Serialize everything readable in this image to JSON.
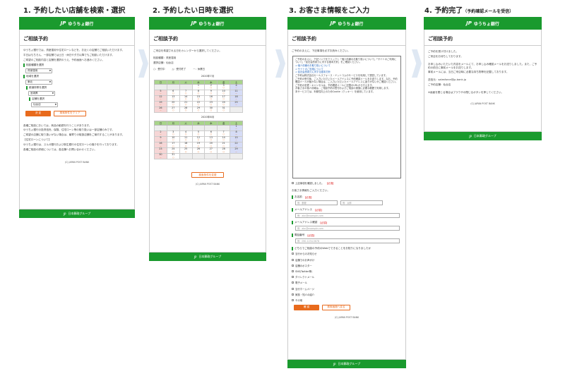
{
  "steps": [
    {
      "title": "1. 予約したい店舗を検索・選択"
    },
    {
      "title": "2. 予約したい日時を選択"
    },
    {
      "title": "3. お客さま情報をご入力"
    },
    {
      "title": "4. 予約完了",
      "note": "（予約確認メールを受信）"
    }
  ],
  "header": {
    "logo": "JP",
    "bank": "ゆうちょ銀行"
  },
  "footer": {
    "copyright": "(C) JAPAN POST BANK",
    "group": "日本郵政グループ"
  },
  "page_title": "ご相談予約",
  "p1": {
    "intro": [
      "ゆうちょ銀行では、資産運用や住宅ローンなどを、お近くの店舗でご相談いただけます。",
      "平日はもちろん、一部店舗では土日・休日や夕方以降でもご相談いただけます。",
      "ご希望のご相談内容と店舗を選択のうえ、予約画面へお進みください。"
    ],
    "f1": "相談種類を選択",
    "v1": "資産運用",
    "f2": "地域を選択",
    "v2": "東北",
    "f3": "都道府県を選択",
    "v3": "宮城県",
    "f4": "店舗を選択",
    "v4": "仙台店",
    "btn_ok": "決 定",
    "btn_clear": "検索条件をクリア",
    "notes": [
      "各種ご相談においては、商品の勧誘を行うことがあります。",
      "ゆうちょ銀行の投資信託、保険、住宅ローン等の取り扱いは一部店舗のみです。",
      "ご希望の店舗に取り扱いがない場合は、最寄りの取扱店舗をご案内することがあります。",
      "【住宅ローンについて】",
      "ゆうちょ銀行は、スルガ銀行および新生銀行の住宅ローンの媒介を行っております。",
      "各種ご相談の詳細については、各店舗へお問い合わせください。"
    ]
  },
  "p2": {
    "intro": "ご来店を希望される日をカレンダーから選択してください。",
    "type_label": "相談種類：資産運用",
    "store_label": "選択店舗：仙台店",
    "legend": [
      "○：受付中",
      "△：受付終了",
      "－：休業日"
    ],
    "months": [
      {
        "name": "2020年7月",
        "rows": [
          [
            [
              "",
              ""
            ],
            [
              "",
              ""
            ],
            [
              "",
              ""
            ],
            [
              "1",
              "－"
            ],
            [
              "2",
              "○"
            ],
            [
              "3",
              "○"
            ],
            [
              "4",
              "－"
            ]
          ],
          [
            [
              "5",
              "－"
            ],
            [
              "6",
              "○"
            ],
            [
              "7",
              "○"
            ],
            [
              "8",
              "○"
            ],
            [
              "9",
              "○"
            ],
            [
              "10",
              "○"
            ],
            [
              "11",
              "－"
            ]
          ],
          [
            [
              "12",
              "－"
            ],
            [
              "13",
              "○"
            ],
            [
              "14",
              "○"
            ],
            [
              "15",
              "○"
            ],
            [
              "16",
              "○"
            ],
            [
              "17",
              "○"
            ],
            [
              "18",
              "－"
            ]
          ],
          [
            [
              "19",
              "－"
            ],
            [
              "20",
              "○"
            ],
            [
              "21",
              "○"
            ],
            [
              "22",
              "○"
            ],
            [
              "23",
              "○"
            ],
            [
              "24",
              "○"
            ],
            [
              "25",
              "－"
            ]
          ],
          [
            [
              "26",
              "－"
            ],
            [
              "27",
              "○"
            ],
            [
              "28",
              "○"
            ],
            [
              "29",
              "○"
            ],
            [
              "30",
              "○"
            ],
            [
              "31",
              "○"
            ],
            [
              "",
              ""
            ]
          ]
        ]
      },
      {
        "name": "2020年8月",
        "rows": [
          [
            [
              "",
              ""
            ],
            [
              "",
              ""
            ],
            [
              "",
              ""
            ],
            [
              "",
              ""
            ],
            [
              "",
              ""
            ],
            [
              "",
              ""
            ],
            [
              "1",
              "－"
            ]
          ],
          [
            [
              "2",
              "－"
            ],
            [
              "3",
              "○"
            ],
            [
              "4",
              "○"
            ],
            [
              "5",
              "○"
            ],
            [
              "6",
              "○"
            ],
            [
              "7",
              "○"
            ],
            [
              "8",
              "－"
            ]
          ],
          [
            [
              "9",
              "－"
            ],
            [
              "10",
              "○"
            ],
            [
              "11",
              "○"
            ],
            [
              "12",
              "○"
            ],
            [
              "13",
              "○"
            ],
            [
              "14",
              "○"
            ],
            [
              "15",
              "－"
            ]
          ],
          [
            [
              "16",
              "－"
            ],
            [
              "17",
              "○"
            ],
            [
              "18",
              "○"
            ],
            [
              "19",
              "○"
            ],
            [
              "20",
              "○"
            ],
            [
              "21",
              "○"
            ],
            [
              "22",
              "－"
            ]
          ],
          [
            [
              "23",
              "－"
            ],
            [
              "24",
              "○"
            ],
            [
              "25",
              "○"
            ],
            [
              "26",
              "○"
            ],
            [
              "27",
              "○"
            ],
            [
              "28",
              "○"
            ],
            [
              "29",
              "－"
            ]
          ],
          [
            [
              "30",
              "－"
            ],
            [
              "31",
              "○"
            ],
            [
              "",
              ""
            ],
            [
              "",
              ""
            ],
            [
              "",
              ""
            ],
            [
              "",
              ""
            ],
            [
              "",
              ""
            ]
          ]
        ]
      }
    ],
    "weekdays": [
      "日",
      "月",
      "火",
      "水",
      "木",
      "金",
      "土"
    ],
    "btn_back": "検索条件を変更"
  },
  "p3": {
    "intro": "ご予約のまえに、下記事項を必ずお読みください。",
    "box": [
      "ご予約のまえに、下記リンクをクリックし「個人情報のお取り扱いについて」「サイトのご利用について」「反社会的勢力に対する基本方針」をご確認ください。",
      "⇒ 個人情報のお取り扱いについて",
      "⇒ サイトのご利用について",
      "⇒ 反社会的勢力に対する基本方針",
      "ご予約は株式会社セールスフォース・ドットコムのサービスを利用して運営しています。",
      "ご予約の受付後、ご入力いただいたメールアドレスに予約確認メールをお送りします。なお、予約確認メールが届かない場合は、ご入力いただいたメールアドレスに誤りがないかご確認ください。",
      "ご予約の変更・キャンセルは、予約確認メールに記載のURLから行えます。",
      "お客さまの個人情報は、ご相談予約の受付およびご相談の実施に必要な範囲で利用します。",
      "本サービスでは、利便性向上のためCookie（クッキー）を使用しています。"
    ],
    "agree": "上記事項を確認しました。",
    "agree_req": "【必須】",
    "enter": "お客さま情報をご入力ください。",
    "name_label": "お名前",
    "name_req": "【必須】",
    "name_ph1": "例：郵便",
    "name_ph2": "例：太郎",
    "mail_label": "メールアドレス",
    "mail_req": "【必須】",
    "mail_ph": "例：abc@example.com",
    "mail2_label": "メールアドレス確認",
    "mail2_req": "【必須】",
    "mail2_ph": "例：abc@example.com",
    "tel_label": "電話番号",
    "tel_req": "【必須】",
    "tel_ph": "例：090-1234-5678",
    "q_label": "どちらでご相談の予約のWebでできることをお知りになりましたか",
    "options": [
      "当行からのお知らせ",
      "店舗でのお声がけ",
      "店舗のポスター",
      "SNS(Twitter等)",
      "ダイレクトメール",
      "電子メール",
      "当行ホームページ",
      "家族・知人の紹介",
      "その他"
    ],
    "btn_ok": "確 認",
    "btn_back": "検索画面へ戻る"
  },
  "p4": {
    "lines": [
      "ご予約を受け付けました。",
      "ご来店をお待ちしております。",
      "",
      "お申し込みいただいた内容をメールにて、お申し込み確認メールをお送りしました。また、ご予約の前日に事前メールをお送りします。",
      "事前メールには、当日ご来店時に必要な持ち物等を記載しております。",
      "",
      "送信元：salesforce@jp-bank.jp",
      "ご予約店舗：仙台店"
    ],
    "note": "※画面を閉じる場合はブラウザの閉じるボタンを押してください。"
  }
}
